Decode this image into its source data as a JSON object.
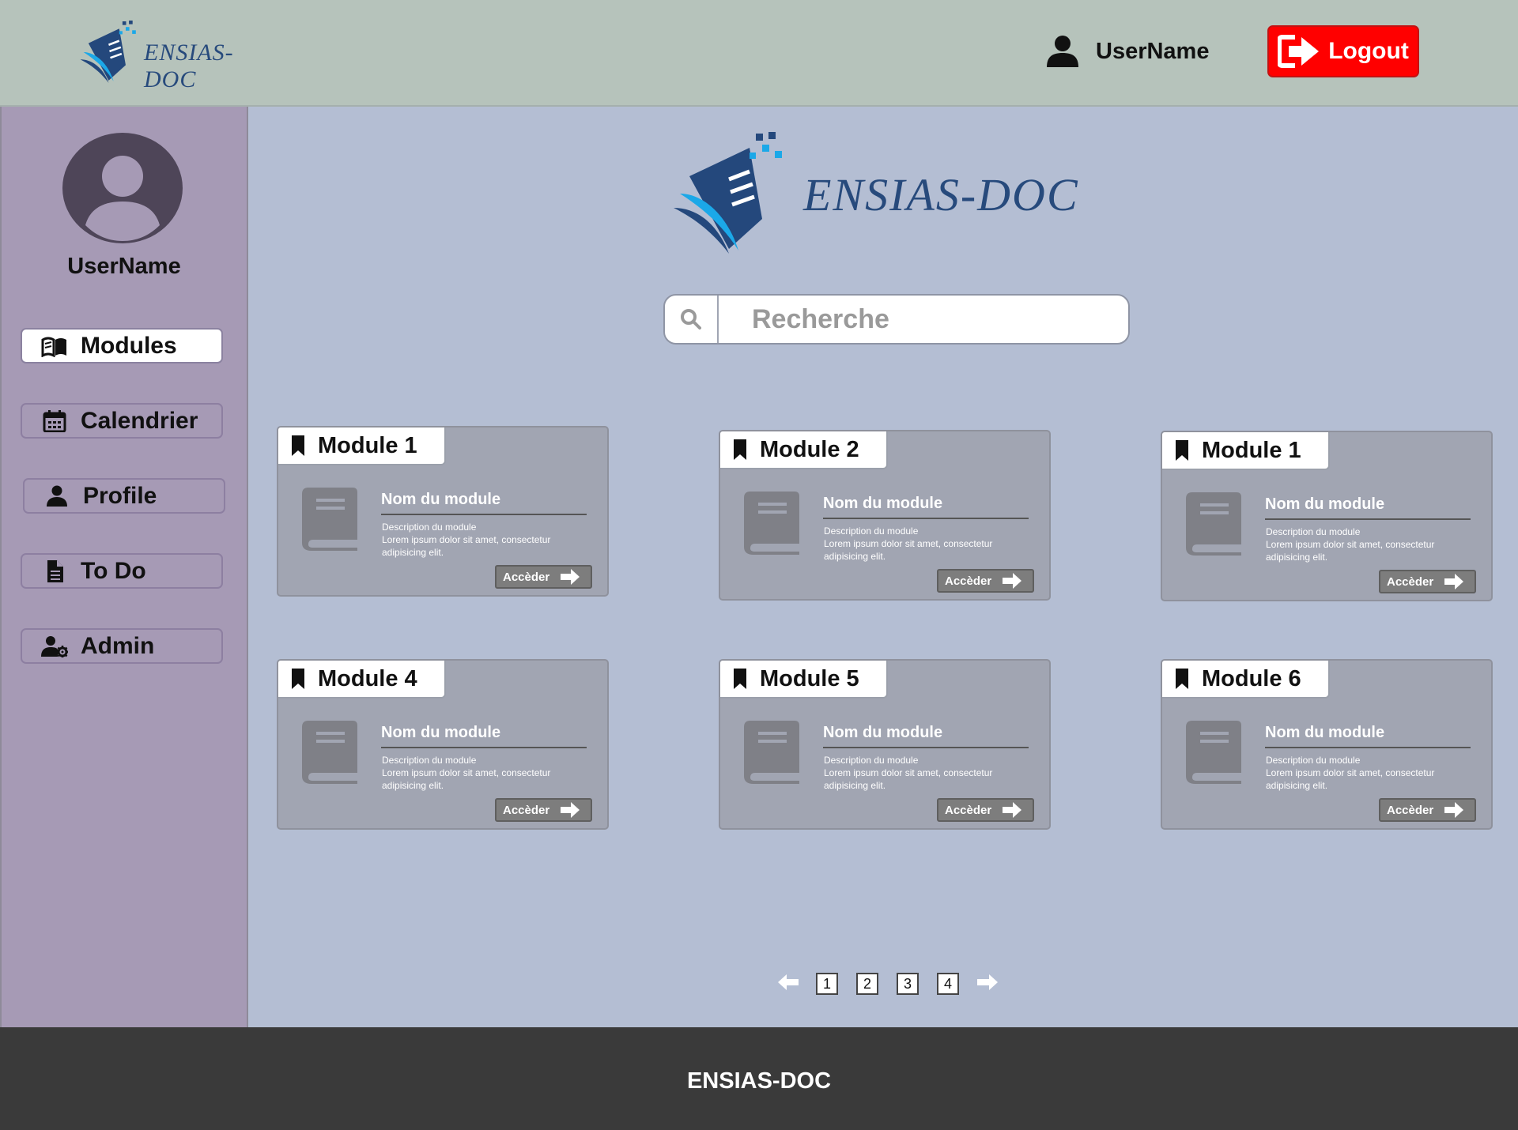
{
  "header": {
    "brand": "ENSIAS-DOC",
    "username": "UserName",
    "logout_label": "Logout"
  },
  "sidebar": {
    "username": "UserName",
    "items": [
      {
        "label": "Modules",
        "icon": "open-book-icon",
        "active": true
      },
      {
        "label": "Calendrier",
        "icon": "calendar-icon",
        "active": false
      },
      {
        "label": "Profile",
        "icon": "user-icon",
        "active": false
      },
      {
        "label": "To Do",
        "icon": "file-icon",
        "active": false
      },
      {
        "label": "Admin",
        "icon": "user-cog-icon",
        "active": false
      }
    ]
  },
  "main": {
    "brand": "ENSIAS-DOC",
    "search": {
      "placeholder": "Recherche",
      "value": ""
    },
    "cards": [
      {
        "title": "Module 1",
        "name": "Nom du module",
        "desc_title": "Description du module",
        "desc_text": "Lorem ipsum dolor sit amet, consectetur adipisicing elit.",
        "button": "Accèder"
      },
      {
        "title": "Module 2",
        "name": "Nom du module",
        "desc_title": "Description du module",
        "desc_text": "Lorem ipsum dolor sit amet, consectetur adipisicing elit.",
        "button": "Accèder"
      },
      {
        "title": "Module 1",
        "name": "Nom du module",
        "desc_title": "Description du module",
        "desc_text": "Lorem ipsum dolor sit amet, consectetur adipisicing elit.",
        "button": "Accèder"
      },
      {
        "title": "Module 4",
        "name": "Nom du module",
        "desc_title": "Description du module",
        "desc_text": "Lorem ipsum dolor sit amet, consectetur adipisicing elit.",
        "button": "Accèder"
      },
      {
        "title": "Module 5",
        "name": "Nom du module",
        "desc_title": "Description du module",
        "desc_text": "Lorem ipsum dolor sit amet, consectetur adipisicing elit.",
        "button": "Accèder"
      },
      {
        "title": "Module 6",
        "name": "Nom du module",
        "desc_title": "Description du module",
        "desc_text": "Lorem ipsum dolor sit amet, consectetur adipisicing elit.",
        "button": "Accèder"
      }
    ],
    "pagination": {
      "pages": [
        "1",
        "2",
        "3",
        "4"
      ]
    }
  },
  "footer": {
    "text": "ENSIAS-DOC"
  },
  "colors": {
    "header_bg": "#b6c3bb",
    "sidebar_bg": "#a69ab5",
    "main_bg": "#b4bed3",
    "card_bg": "#a1a5b2",
    "logout_bg": "#ff0000",
    "footer_bg": "#3a3a3a",
    "brand_blue": "#274a7c",
    "accent_blue": "#1ba8e8"
  }
}
